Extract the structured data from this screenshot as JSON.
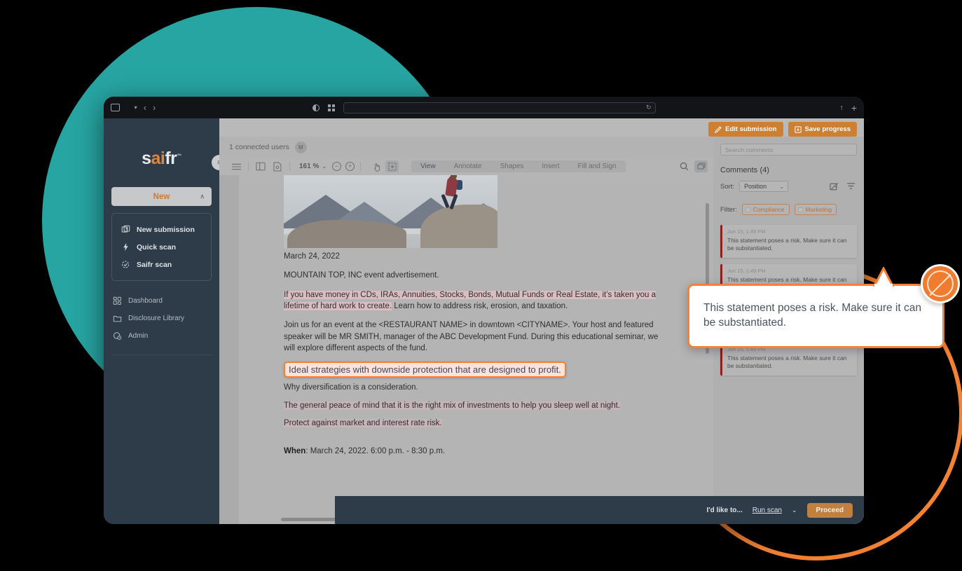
{
  "browser": {
    "url_value": "",
    "url_placeholder": "",
    "icons": {
      "sidebar_toggle": "sidebar-toggle-icon",
      "back": "‹",
      "forward": "›",
      "contrast": "contrast-icon",
      "tab_overview": "tab-overview-icon",
      "reload": "↻",
      "share": "↑",
      "new_tab": "+"
    }
  },
  "sidebar": {
    "logo": {
      "part1": "s",
      "part2": "ai",
      "part3": "fr",
      "tm": "™"
    },
    "collapse_icon": "≡",
    "new_button": {
      "label": "New",
      "chevron": "∧"
    },
    "new_panel_items": [
      {
        "label": "New submission",
        "icon": "new-submission-icon"
      },
      {
        "label": "Quick scan",
        "icon": "lightning-icon"
      },
      {
        "label": "Saifr scan",
        "icon": "scan-badge-icon"
      }
    ],
    "items": [
      {
        "label": "Dashboard",
        "icon": "dashboard-grid-icon"
      },
      {
        "label": "Disclosure Library",
        "icon": "folder-icon"
      },
      {
        "label": "Admin",
        "icon": "admin-gear-icon"
      }
    ]
  },
  "header": {
    "connected_users": "1 connected users",
    "avatar_initial": "M",
    "edit_submission": "Edit submission",
    "save_progress": "Save progress"
  },
  "doc_toolbar": {
    "menu_icon": "hamburger-menu-icon",
    "panel_icon": "layout-panel-icon",
    "page_icon": "page-thumbnail-icon",
    "zoom_value": "161 %",
    "zoom_chevron": "⌄",
    "zoom_out": "−",
    "zoom_in": "+",
    "pan_icon": "pan-hand-icon",
    "select_icon": "marquee-select-icon",
    "tabs": [
      {
        "label": "View",
        "active": true
      },
      {
        "label": "Annotate",
        "active": false
      },
      {
        "label": "Shapes",
        "active": false
      },
      {
        "label": "Insert",
        "active": false
      },
      {
        "label": "Fill and Sign",
        "active": false
      }
    ],
    "search_icon": "search-icon",
    "comments_icon": "comments-icon"
  },
  "document": {
    "date": "March 24, 2022",
    "subject": "MOUNTAIN TOP, INC event advertisement.",
    "para_highlighted_a": "If you have money in CDs, IRAs, Annuities, Stocks, Bonds, Mutual Funds or Real Estate, it’s taken you a lifetime of hard work to create.",
    "para_plain_a": "  Learn how to address risk, erosion, and taxation.",
    "para_b": "Join us for an event at the <RESTAURANT NAME> in downtown <CITYNAME>.  Your host and featured speaker will be MR SMITH, manager of the ABC Development Fund.  During this educational seminar, we will explore different aspects of the fund.",
    "selected_line": "Ideal strategies with downside protection that are designed to profit.",
    "line_why": "Why diversification is a consideration.",
    "line_peace": "The general peace of mind that it is the right mix of investments to help you sleep well at night.",
    "line_protect": "Protect against market and interest rate risk.",
    "when_label": "When",
    "when_value": ": March 24, 2022. 6:00 p.m. - 8:30 p.m."
  },
  "comments_panel": {
    "search_placeholder": "Search comments",
    "title": "Comments",
    "count": "(4)",
    "sort_label": "Sort:",
    "sort_value": "Position",
    "sort_chevron": "⌄",
    "copy_icon": "copy-annotation-icon",
    "filter_icon": "filter-icon",
    "filter_label": "Filter:",
    "filter_chips": [
      {
        "label": "Compliance"
      },
      {
        "label": "Marketing"
      }
    ],
    "comments": [
      {
        "time": "Jun 15, 1:49 PM",
        "text": "This statement poses a risk. Make sure it can be substantiated."
      },
      {
        "time": "Jun 15, 1:49 PM",
        "text": "This statement poses a risk. Make sure it can be substantiated."
      },
      {
        "time": "Jun 15, 1:49 PM",
        "text": "This statement poses a risk. Make sure it can be substantiated."
      },
      {
        "time": "Jun 15, 1:49 PM",
        "text": "This statement poses a risk. Make sure it can be substantiated."
      }
    ]
  },
  "bottom_bar": {
    "prompt": "I'd like to...",
    "action_link": "Run scan",
    "action_chevron": "⌄",
    "proceed": "Proceed"
  },
  "callout": {
    "text": "This statement poses a risk. Make sure it can be substantiated.",
    "badge_icon": "prohibited-circle-icon"
  },
  "colors": {
    "teal": "#27a5a3",
    "orange": "#f58233",
    "brand_orange": "#e0863c",
    "dark_navy": "#2e3c4a",
    "comment_accent": "#8d2020",
    "proceed_button": "#c2803f"
  }
}
